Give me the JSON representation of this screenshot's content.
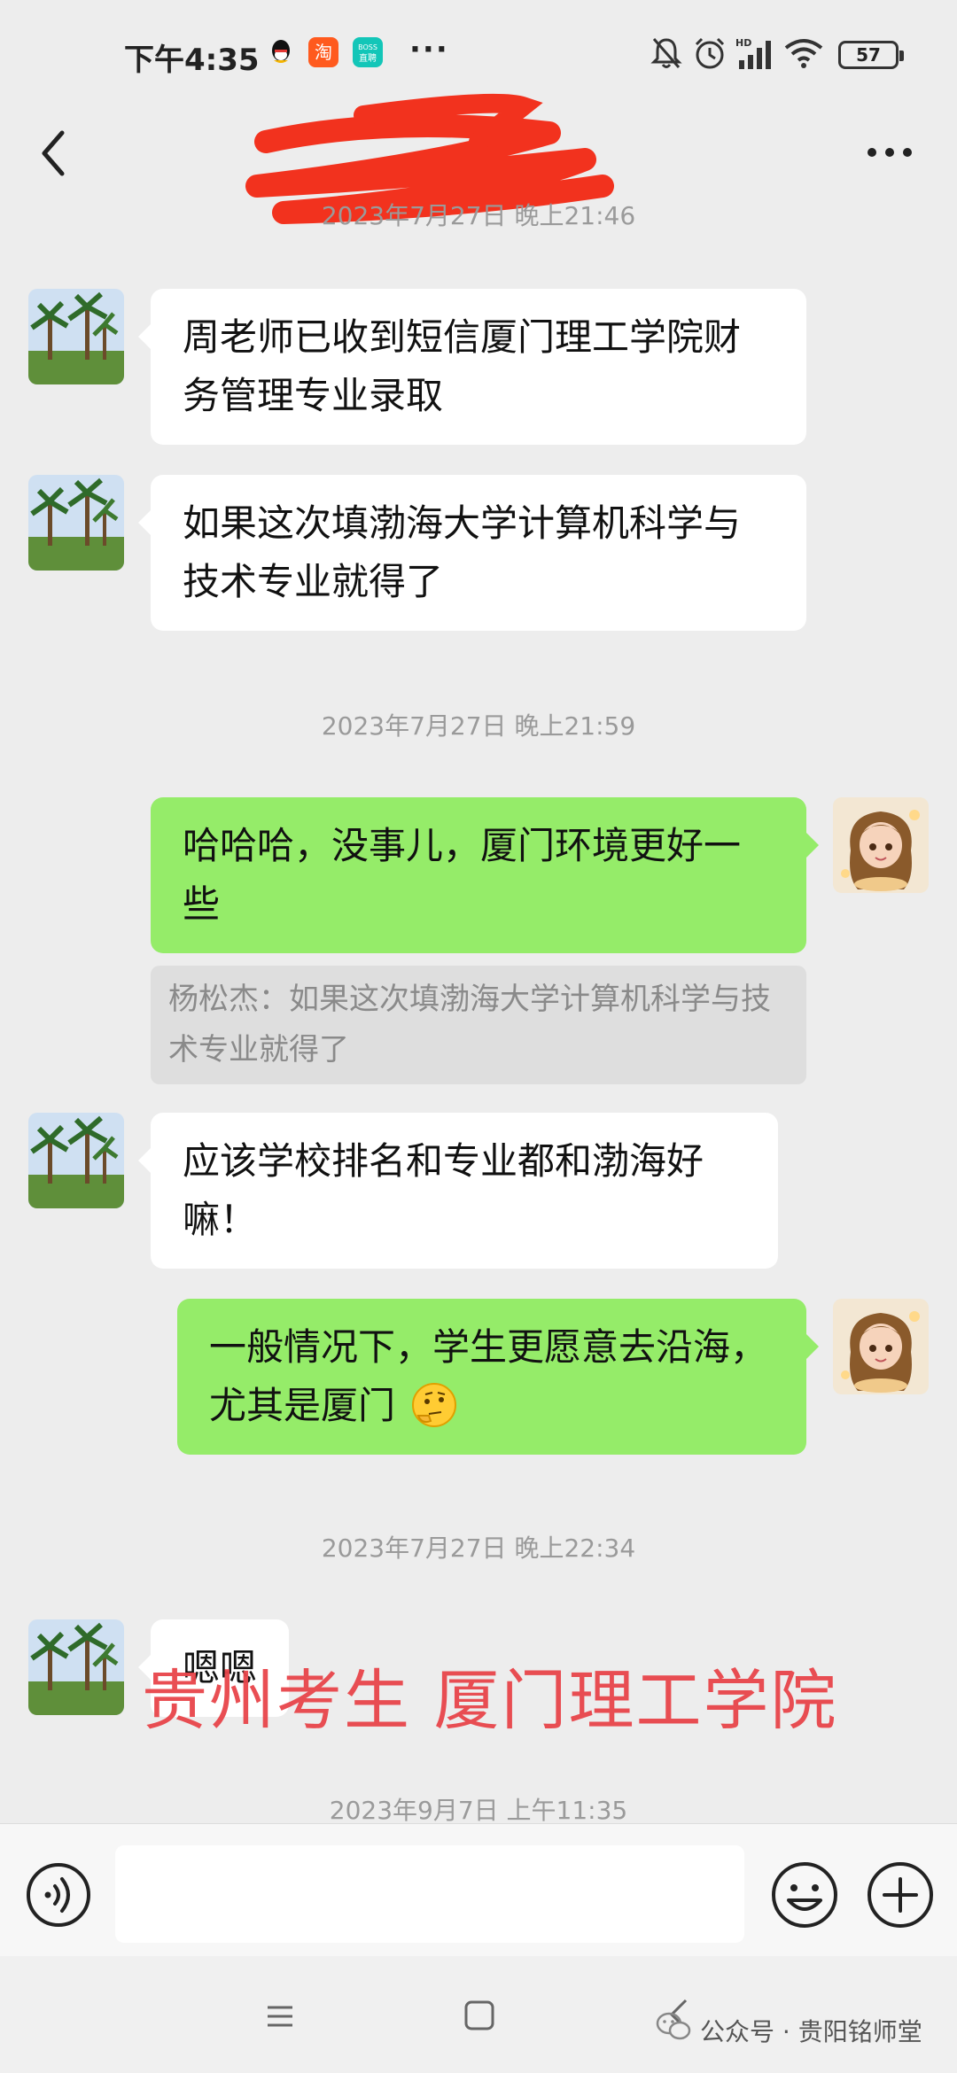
{
  "status_bar": {
    "time": "下午4:35",
    "more_indicator": "···",
    "battery": "57",
    "icons": [
      "qq-icon",
      "taobao-icon",
      "boss-zhipin-icon",
      "mute-icon",
      "alarm-icon",
      "signal-icon",
      "wifi-icon",
      "battery-icon"
    ]
  },
  "header": {
    "back_icon": "back-chevron-icon",
    "more_icon": "more-dots-icon",
    "title_redacted": true
  },
  "messages": {
    "ts1": "2023年7月27日 晚上21:46",
    "m1": "周老师已收到短信厦门理工学院财务管理专业录取",
    "m2": "如果这次填渤海大学计算机科学与技术专业就得了",
    "ts2": "2023年7月27日 晚上21:59",
    "m3": "哈哈哈，没事儿，厦门环境更好一些",
    "quote": "杨松杰：如果这次填渤海大学计算机科学与技术专业就得了",
    "m4": "应该学校排名和专业都和渤海好嘛！",
    "m5": "一般情况下，学生更愿意去沿海，尤其是厦门",
    "ts3": "2023年7月27日 晚上22:34",
    "m6": "嗯嗯",
    "ts4": "2023年9月7日 上午11:35"
  },
  "overlay": {
    "red_caption": "贵州考生  厦门理工学院",
    "footer_watermark": "公众号 · 贵阳铭师堂"
  },
  "input_bar": {
    "value": "",
    "placeholder": ""
  },
  "colors": {
    "background": "#ededed",
    "incoming_bubble": "#ffffff",
    "outgoing_bubble": "#95ec69",
    "timestamp": "#9a9a9a",
    "red_caption": "#e8454a",
    "redaction_scribble": "#f2321e"
  }
}
